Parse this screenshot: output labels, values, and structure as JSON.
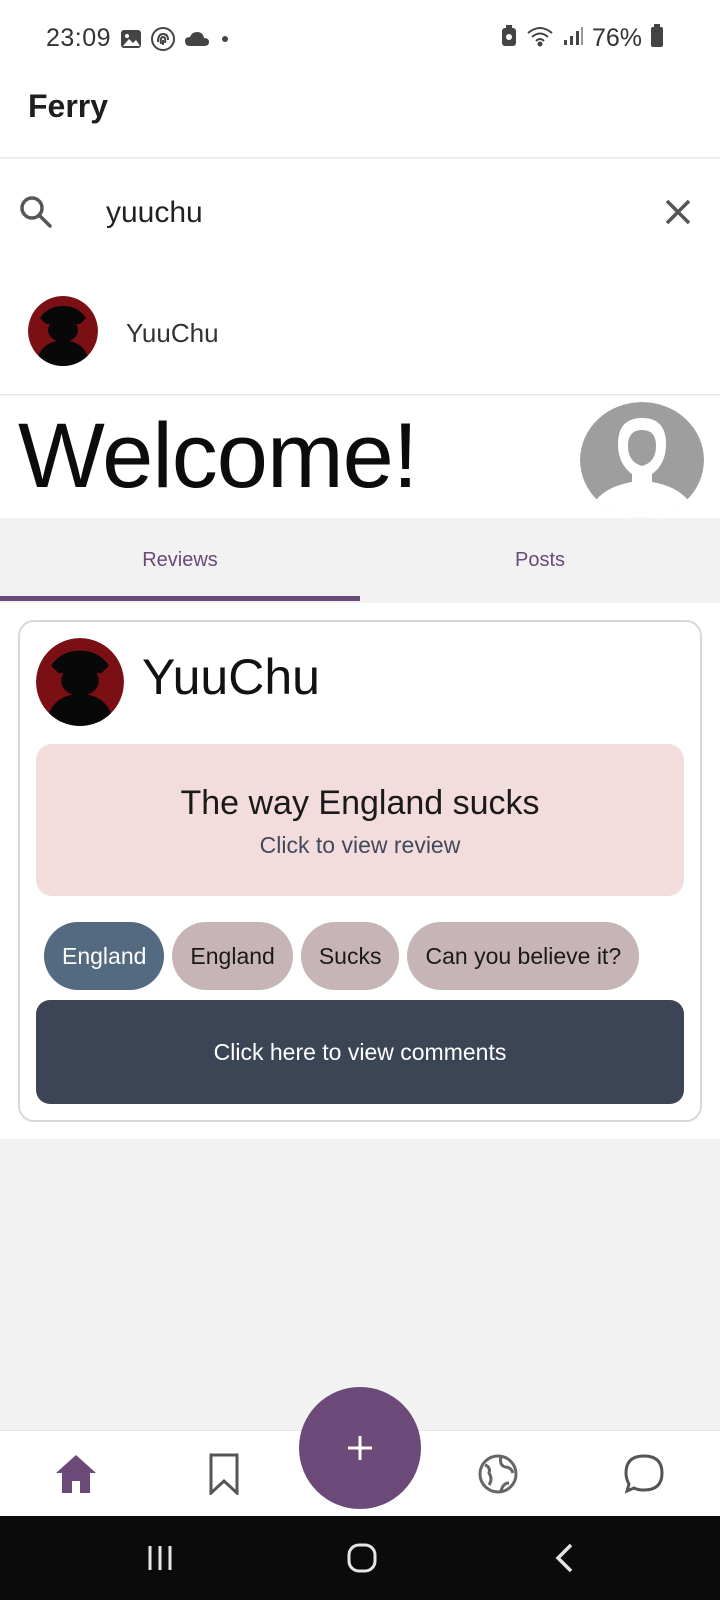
{
  "status_bar": {
    "time": "23:09",
    "battery": "76%",
    "left_icons": [
      "image-icon",
      "fingerprint-icon",
      "cloud-icon",
      "dot-icon"
    ],
    "right_icons": [
      "battery-saver-icon",
      "wifi-icon",
      "signal-icon",
      "battery-icon"
    ]
  },
  "appbar": {
    "title": "Ferry"
  },
  "search": {
    "value": "yuuchu"
  },
  "search_result": {
    "name": "YuuChu"
  },
  "profile": {
    "welcome": "Welcome!"
  },
  "tabs": [
    {
      "label": "Reviews",
      "active": true
    },
    {
      "label": "Posts",
      "active": false
    }
  ],
  "review": {
    "author": "YuuChu",
    "title": "The way England sucks",
    "subtitle": "Click to view review",
    "tags": [
      "England",
      "England",
      "Sucks",
      "Can you believe it?"
    ],
    "comments_label": "Click here to view comments"
  },
  "bottom_nav": [
    "home-icon",
    "bookmark-icon",
    "add-icon",
    "globe-icon",
    "chat-icon"
  ],
  "colors": {
    "accent": "#6b4a7a",
    "review_box": "#f3dcdc",
    "tag": "#c7b4b7",
    "tag_primary": "#536a80",
    "comments_button": "#3b4556"
  }
}
